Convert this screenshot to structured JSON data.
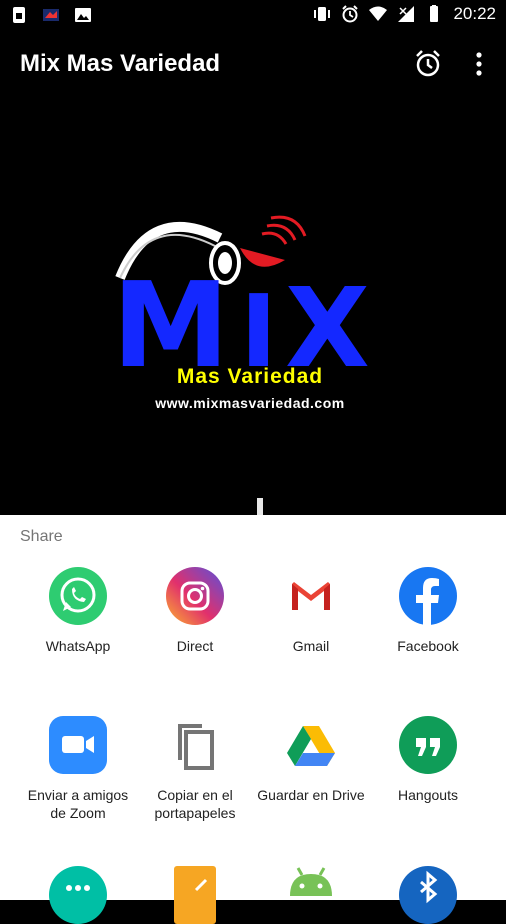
{
  "status_bar": {
    "time": "20:22",
    "left_icons": [
      "sim-card-icon",
      "notification-app-icon",
      "image-icon"
    ],
    "right_icons": [
      "vibrate-icon",
      "alarm-icon",
      "wifi-icon",
      "signal-icon",
      "battery-icon"
    ]
  },
  "app_bar": {
    "title": "Mix Mas Variedad",
    "actions": [
      "alarm-icon",
      "more-vert-icon"
    ]
  },
  "hero": {
    "logo_text": "MIX",
    "slogan": "Mas Variedad",
    "url": "www.mixmasvariedad.com"
  },
  "share_sheet": {
    "title": "Share",
    "apps": [
      {
        "label": "WhatsApp",
        "icon": "whatsapp-icon",
        "color": "#25d366"
      },
      {
        "label": "Direct",
        "icon": "instagram-icon",
        "color": "#c13584"
      },
      {
        "label": "Gmail",
        "icon": "gmail-icon",
        "color": "#ea4335"
      },
      {
        "label": "Facebook",
        "icon": "facebook-icon",
        "color": "#1877f2"
      },
      {
        "label": "Enviar a amigos de Zoom",
        "icon": "zoom-icon",
        "color": "#2d8cff"
      },
      {
        "label": "Copiar en el portapapeles",
        "icon": "copy-icon",
        "color": "#757575"
      },
      {
        "label": "Guardar en Drive",
        "icon": "google-drive-icon",
        "color": "#fbbc04"
      },
      {
        "label": "Hangouts",
        "icon": "hangouts-icon",
        "color": "#0f9d58"
      },
      {
        "label": "",
        "icon": "messages-icon",
        "color": "#00bfa5"
      },
      {
        "label": "",
        "icon": "notes-icon",
        "color": "#f6a623"
      },
      {
        "label": "",
        "icon": "android-icon",
        "color": "#78c257"
      },
      {
        "label": "",
        "icon": "bluetooth-icon",
        "color": "#1565c0"
      }
    ]
  }
}
